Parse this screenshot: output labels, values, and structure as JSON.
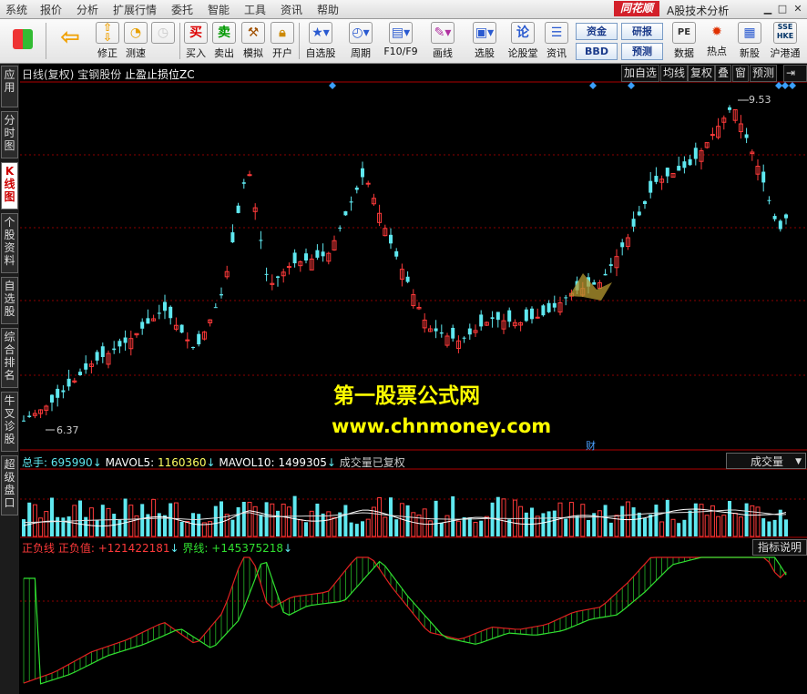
{
  "menu": {
    "items": [
      "系统",
      "报价",
      "分析",
      "扩展行情",
      "委托",
      "智能",
      "工具",
      "资讯",
      "帮助"
    ],
    "logo": "同花顺",
    "app_title": "A股技术分析"
  },
  "toolbar": {
    "buttons": [
      {
        "label": "",
        "icon": "grid-icon"
      },
      {
        "label": "",
        "icon": "back-arrow-icon"
      },
      {
        "label": "修正",
        "icon": "up-down-arrows-icon"
      },
      {
        "label": "测速",
        "icon": "speedometer-icon"
      },
      {
        "label": "买入",
        "icon": "buy-icon",
        "glyph": "买"
      },
      {
        "label": "卖出",
        "icon": "sell-icon",
        "glyph": "卖"
      },
      {
        "label": "模拟",
        "icon": "hammer-icon"
      },
      {
        "label": "开户",
        "icon": "lock-icon"
      },
      {
        "label": "自选股",
        "icon": "star-folder-icon"
      },
      {
        "label": "周期",
        "icon": "clock-icon"
      },
      {
        "label": "F10/F9",
        "icon": "document-icon"
      },
      {
        "label": "画线",
        "icon": "pencil-icon"
      },
      {
        "label": "选股",
        "icon": "monitor-icon"
      },
      {
        "label": "论股堂",
        "icon": "discuss-icon",
        "glyph": "论"
      },
      {
        "label": "资讯",
        "icon": "news-icon"
      },
      {
        "label": "数据",
        "icon": "pe-icon",
        "glyph": "PE"
      },
      {
        "label": "热点",
        "icon": "hot-icon"
      },
      {
        "label": "新股",
        "icon": "new-stock-icon"
      },
      {
        "label": "沪港通",
        "icon": "sse-hkex-icon"
      }
    ],
    "small_buttons": [
      "资金",
      "BBD",
      "研报",
      "预测"
    ]
  },
  "left_tabs": [
    "应用",
    "分时图",
    "K线图",
    "个股资料",
    "自选股",
    "综合排名",
    "牛叉诊股",
    "超级盘口"
  ],
  "kline_header": {
    "period": "日线(复权)",
    "stock": "宝钢股份",
    "indicator": "止盈止损位ZC"
  },
  "kline_buttons": [
    "加自选",
    "均线",
    "复权",
    "叠",
    "窗",
    "预测"
  ],
  "price_labels": {
    "high": "9.53",
    "low": "6.37"
  },
  "finance_marker": "财",
  "volume_header": {
    "total_label": "总手:",
    "total": "695990",
    "total_arrow": "↓",
    "ma5_label": "MAVOL5:",
    "ma5": "1160360",
    "ma5_arrow": "↓",
    "ma10_label": "MAVOL10:",
    "ma10": "1499305",
    "ma10_arrow": "↓",
    "note": "成交量已复权",
    "dropdown": "成交量"
  },
  "indicator_header": {
    "name": "正负线",
    "pos_label": "正负值:",
    "pos_value": "+121422181",
    "pos_arrow": "↓",
    "line_label": "界线:",
    "line_value": "+145375218",
    "line_arrow": "↓",
    "explain_button": "指标说明"
  },
  "watermark": {
    "line1": "第一股票公式网",
    "line2": "www.chnmoney.com"
  },
  "colors": {
    "up": "#ff3a3a",
    "down": "#5fe8f0",
    "grid": "#8b0000",
    "diamond": "#3a9fff",
    "line_red": "#e02020",
    "line_green": "#30e030",
    "ma_white": "#ffffff",
    "ma_yellow": "#ffff60"
  }
}
